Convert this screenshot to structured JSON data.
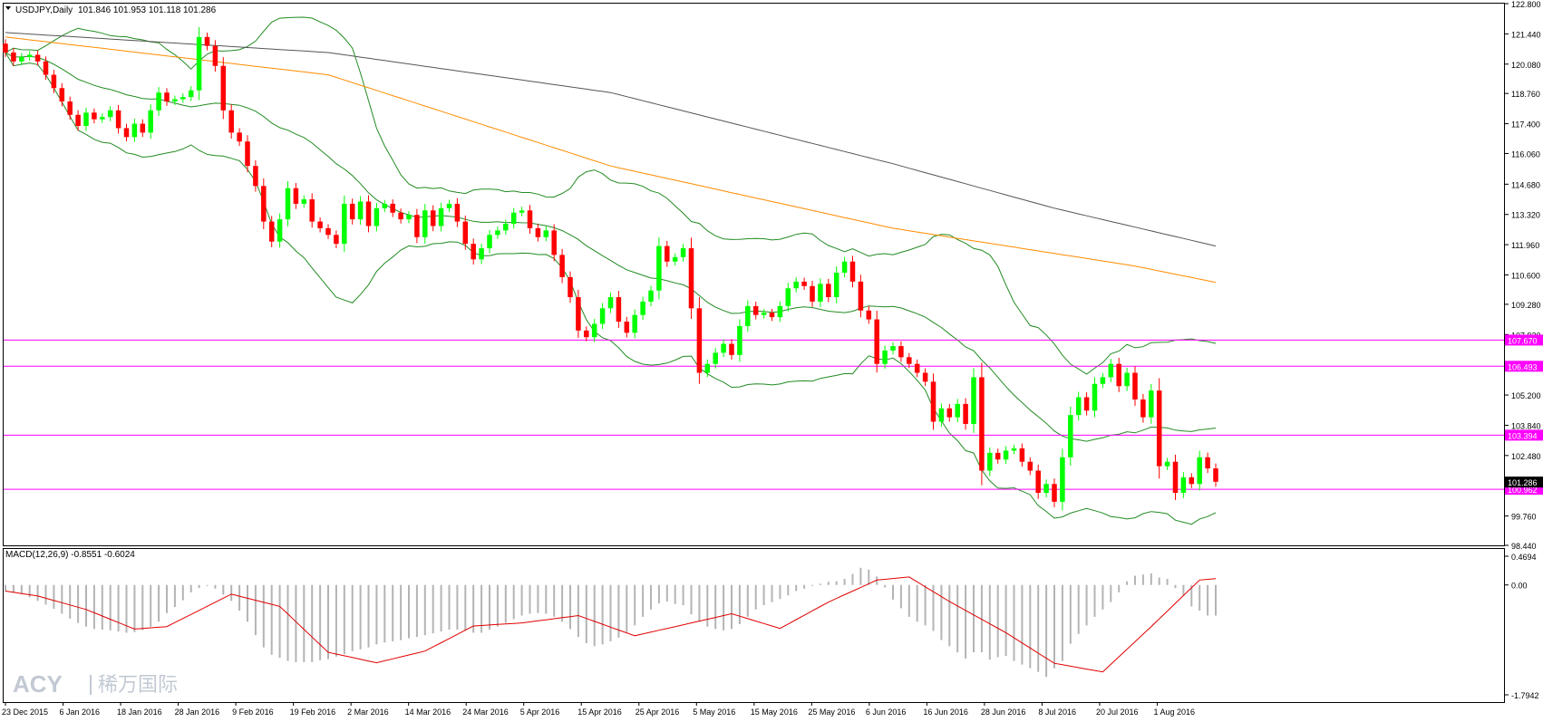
{
  "header": {
    "symbol_label": "USDJPY,Daily",
    "ohlc_label": "101.846 101.953 101.118 101.286",
    "macd_label": "MACD(12,26,9) -0.8551 -0.6024",
    "watermark_brand": "ACY",
    "watermark_cn": "稀万国际"
  },
  "colors": {
    "bull": "#00ff00",
    "bear": "#ff0000",
    "bollinger": "#228b22",
    "ma_orange": "#ff8c00",
    "ma_gray": "#555555",
    "hline": "#ff00ff",
    "macd_hist": "#b4b4b4",
    "macd_signal": "#e00000",
    "current_price_tag": "#000000"
  },
  "chart_data": [
    {
      "type": "candlestick",
      "title": "USDJPY,Daily",
      "y_axis": {
        "range": [
          98.44,
          122.8
        ],
        "ticks": [
          "122.800",
          "121.440",
          "120.080",
          "118.760",
          "117.400",
          "116.060",
          "114.680",
          "113.320",
          "111.960",
          "110.600",
          "109.280",
          "107.920",
          "105.200",
          "103.840",
          "102.480",
          "99.760",
          "98.440"
        ]
      },
      "x_axis": {
        "ticks": [
          "23 Dec 2015",
          "6 Jan 2016",
          "18 Jan 2016",
          "28 Jan 2016",
          "9 Feb 2016",
          "19 Feb 2016",
          "2 Mar 2016",
          "14 Mar 2016",
          "24 Mar 2016",
          "5 Apr 2016",
          "15 Apr 2016",
          "25 Apr 2016",
          "5 May 2016",
          "15 May 2016",
          "25 May 2016",
          "6 Jun 2016",
          "16 Jun 2016",
          "28 Jun 2016",
          "8 Jul 2016",
          "20 Jul 2016",
          "1 Aug 2016"
        ]
      },
      "current_price": "101.286",
      "horizontal_levels": [
        {
          "value": 107.67,
          "label": "107.670"
        },
        {
          "value": 106.493,
          "label": "106.493"
        },
        {
          "value": 103.394,
          "label": "103.394"
        },
        {
          "value": 100.962,
          "label": "100.962"
        }
      ],
      "candles": [
        [
          121.0,
          120.6
        ],
        [
          120.6,
          120.2
        ],
        [
          120.2,
          120.4
        ],
        [
          120.4,
          120.5
        ],
        [
          120.5,
          120.2
        ],
        [
          120.2,
          119.6
        ],
        [
          119.6,
          119.0
        ],
        [
          119.0,
          118.4
        ],
        [
          118.4,
          117.8
        ],
        [
          117.8,
          117.3
        ],
        [
          117.3,
          117.9
        ],
        [
          117.9,
          117.6
        ],
        [
          117.6,
          117.7
        ],
        [
          117.7,
          118.0
        ],
        [
          118.0,
          117.2
        ],
        [
          117.2,
          116.8
        ],
        [
          116.8,
          117.4
        ],
        [
          117.4,
          117.0
        ],
        [
          117.0,
          118.0
        ],
        [
          118.0,
          118.8
        ],
        [
          118.8,
          118.4
        ],
        [
          118.4,
          118.5
        ],
        [
          118.5,
          118.6
        ],
        [
          118.6,
          118.9
        ],
        [
          118.9,
          121.3
        ],
        [
          121.3,
          120.9
        ],
        [
          120.9,
          120.0
        ],
        [
          120.0,
          118.0
        ],
        [
          118.0,
          117.0
        ],
        [
          117.0,
          116.6
        ],
        [
          116.6,
          115.5
        ],
        [
          115.5,
          114.6
        ],
        [
          114.6,
          113.0
        ],
        [
          113.0,
          112.1
        ],
        [
          112.1,
          113.1
        ],
        [
          113.1,
          114.5
        ],
        [
          114.5,
          113.8
        ],
        [
          113.8,
          114.0
        ],
        [
          114.0,
          113.0
        ],
        [
          113.0,
          112.7
        ],
        [
          112.7,
          112.4
        ],
        [
          112.4,
          112.0
        ],
        [
          112.0,
          113.8
        ],
        [
          113.8,
          113.1
        ],
        [
          113.1,
          113.9
        ],
        [
          113.9,
          112.8
        ],
        [
          112.8,
          113.6
        ],
        [
          113.6,
          113.8
        ],
        [
          113.8,
          113.4
        ],
        [
          113.4,
          113.1
        ],
        [
          113.1,
          113.3
        ],
        [
          113.3,
          112.3
        ],
        [
          112.3,
          113.5
        ],
        [
          113.5,
          112.8
        ],
        [
          112.8,
          113.6
        ],
        [
          113.6,
          113.8
        ],
        [
          113.8,
          113.0
        ],
        [
          113.0,
          112.0
        ],
        [
          112.0,
          111.3
        ],
        [
          111.3,
          111.8
        ],
        [
          111.8,
          112.4
        ],
        [
          112.4,
          112.6
        ],
        [
          112.6,
          112.9
        ],
        [
          112.9,
          113.4
        ],
        [
          113.4,
          113.5
        ],
        [
          113.5,
          112.7
        ],
        [
          112.7,
          112.3
        ],
        [
          112.3,
          112.6
        ],
        [
          112.6,
          111.5
        ],
        [
          111.5,
          110.5
        ],
        [
          110.5,
          109.6
        ],
        [
          109.6,
          108.1
        ],
        [
          108.1,
          107.8
        ],
        [
          107.8,
          108.4
        ],
        [
          108.4,
          109.1
        ],
        [
          109.1,
          109.6
        ],
        [
          109.6,
          108.5
        ],
        [
          108.5,
          108.0
        ],
        [
          108.0,
          108.8
        ],
        [
          108.8,
          109.4
        ],
        [
          109.4,
          109.9
        ],
        [
          109.9,
          111.9
        ],
        [
          111.9,
          111.2
        ],
        [
          111.2,
          111.4
        ],
        [
          111.4,
          111.8
        ],
        [
          111.8,
          109.1
        ],
        [
          109.1,
          106.2
        ],
        [
          106.2,
          106.6
        ],
        [
          106.6,
          107.1
        ],
        [
          107.1,
          107.5
        ],
        [
          107.5,
          107.0
        ],
        [
          107.0,
          108.3
        ],
        [
          108.3,
          109.2
        ],
        [
          109.2,
          108.8
        ],
        [
          108.8,
          108.9
        ],
        [
          108.9,
          108.7
        ],
        [
          108.7,
          109.2
        ],
        [
          109.2,
          110.0
        ],
        [
          110.0,
          110.3
        ],
        [
          110.3,
          110.1
        ],
        [
          110.1,
          109.4
        ],
        [
          109.4,
          110.2
        ],
        [
          110.2,
          109.6
        ],
        [
          109.6,
          110.7
        ],
        [
          110.7,
          111.2
        ],
        [
          111.2,
          110.3
        ],
        [
          110.3,
          109.0
        ],
        [
          109.0,
          108.6
        ],
        [
          108.6,
          106.6
        ],
        [
          106.6,
          107.2
        ],
        [
          107.2,
          107.4
        ],
        [
          107.4,
          106.9
        ],
        [
          106.9,
          106.6
        ],
        [
          106.6,
          106.2
        ],
        [
          106.2,
          105.8
        ],
        [
          105.8,
          104.0
        ],
        [
          104.0,
          104.6
        ],
        [
          104.6,
          104.2
        ],
        [
          104.2,
          104.8
        ],
        [
          104.8,
          103.9
        ],
        [
          103.9,
          106.0
        ],
        [
          106.0,
          101.8
        ],
        [
          101.8,
          102.6
        ],
        [
          102.6,
          102.3
        ],
        [
          102.3,
          102.7
        ],
        [
          102.7,
          102.8
        ],
        [
          102.8,
          102.2
        ],
        [
          102.2,
          101.8
        ],
        [
          101.8,
          100.8
        ],
        [
          100.8,
          101.2
        ],
        [
          101.2,
          100.4
        ],
        [
          100.4,
          102.4
        ],
        [
          102.4,
          104.3
        ],
        [
          104.3,
          105.1
        ],
        [
          105.1,
          104.5
        ],
        [
          104.5,
          105.7
        ],
        [
          105.7,
          106.0
        ],
        [
          106.0,
          106.6
        ],
        [
          106.6,
          105.6
        ],
        [
          105.6,
          106.2
        ],
        [
          106.2,
          105.0
        ],
        [
          105.0,
          104.2
        ],
        [
          104.2,
          105.4
        ],
        [
          105.4,
          102.0
        ],
        [
          102.0,
          102.2
        ],
        [
          102.2,
          100.8
        ],
        [
          100.8,
          101.5
        ],
        [
          101.5,
          101.2
        ],
        [
          101.2,
          102.4
        ],
        [
          102.4,
          101.9
        ],
        [
          101.9,
          101.3
        ]
      ],
      "moving_average_orange": [
        [
          0,
          121.3
        ],
        [
          40,
          119.6
        ],
        [
          75,
          115.5
        ],
        [
          110,
          112.7
        ],
        [
          140,
          111.0
        ],
        [
          170,
          108.8
        ],
        [
          185,
          107.4
        ],
        [
          200,
          105.3
        ]
      ],
      "moving_average_gray": [
        [
          0,
          121.5
        ],
        [
          40,
          120.6
        ],
        [
          75,
          118.8
        ],
        [
          110,
          115.6
        ],
        [
          130,
          113.6
        ],
        [
          150,
          111.9
        ],
        [
          170,
          110.2
        ],
        [
          185,
          108.9
        ],
        [
          200,
          107.6
        ]
      ]
    },
    {
      "type": "bar+line",
      "title": "MACD(12,26,9) -0.8551 -0.6024",
      "y_axis": {
        "range": [
          -1.7942,
          0.4694
        ],
        "ticks": [
          "0.4694",
          "0.00",
          "-1.7942"
        ]
      },
      "histogram": [
        -0.1,
        -0.13,
        -0.15,
        -0.2,
        -0.26,
        -0.32,
        -0.39,
        -0.47,
        -0.55,
        -0.62,
        -0.68,
        -0.72,
        -0.73,
        -0.74,
        -0.76,
        -0.78,
        -0.77,
        -0.74,
        -0.68,
        -0.6,
        -0.46,
        -0.36,
        -0.25,
        -0.12,
        -0.05,
        0.0,
        -0.06,
        -0.16,
        -0.26,
        -0.42,
        -0.6,
        -0.82,
        -1.02,
        -1.14,
        -1.19,
        -1.24,
        -1.26,
        -1.26,
        -1.26,
        -1.23,
        -1.21,
        -1.17,
        -1.13,
        -1.08,
        -1.05,
        -1.02,
        -0.97,
        -0.94,
        -0.92,
        -0.9,
        -0.87,
        -0.85,
        -0.82,
        -0.79,
        -0.76,
        -0.73,
        -0.73,
        -0.75,
        -0.78,
        -0.78,
        -0.73,
        -0.68,
        -0.62,
        -0.56,
        -0.5,
        -0.47,
        -0.46,
        -0.47,
        -0.52,
        -0.6,
        -0.72,
        -0.85,
        -0.95,
        -1.0,
        -0.97,
        -0.92,
        -0.86,
        -0.77,
        -0.66,
        -0.52,
        -0.4,
        -0.3,
        -0.27,
        -0.31,
        -0.33,
        -0.48,
        -0.6,
        -0.68,
        -0.72,
        -0.74,
        -0.72,
        -0.64,
        -0.52,
        -0.4,
        -0.33,
        -0.28,
        -0.23,
        -0.17,
        -0.1,
        -0.06,
        0.0,
        0.02,
        0.05,
        0.06,
        0.1,
        0.18,
        0.28,
        0.25,
        0.14,
        -0.04,
        -0.24,
        -0.38,
        -0.52,
        -0.6,
        -0.66,
        -0.75,
        -0.9,
        -1.0,
        -1.1,
        -1.2,
        -1.1,
        -1.1,
        -1.22,
        -1.18,
        -1.16,
        -1.24,
        -1.3,
        -1.36,
        -1.42,
        -1.5,
        -1.36,
        -1.24,
        -0.96,
        -0.8,
        -0.66,
        -0.52,
        -0.4,
        -0.28,
        -0.12,
        0.06,
        0.15,
        0.17,
        0.19,
        0.12,
        0.1,
        -0.05,
        -0.18,
        -0.35,
        -0.42,
        -0.5,
        -0.5,
        -0.5,
        -0.56,
        -0.54,
        -0.59
      ],
      "signal": [
        [
          0,
          -0.1
        ],
        [
          4,
          -0.18
        ],
        [
          10,
          -0.4
        ],
        [
          16,
          -0.72
        ],
        [
          20,
          -0.68
        ],
        [
          28,
          -0.15
        ],
        [
          34,
          -0.35
        ],
        [
          40,
          -1.1
        ],
        [
          46,
          -1.27
        ],
        [
          52,
          -1.08
        ],
        [
          58,
          -0.67
        ],
        [
          64,
          -0.62
        ],
        [
          71,
          -0.5
        ],
        [
          78,
          -0.83
        ],
        [
          84,
          -0.65
        ],
        [
          90,
          -0.47
        ],
        [
          96,
          -0.71
        ],
        [
          102,
          -0.28
        ],
        [
          108,
          0.08
        ],
        [
          112,
          0.13
        ],
        [
          117,
          -0.27
        ],
        [
          124,
          -0.78
        ],
        [
          130,
          -1.28
        ],
        [
          136,
          -1.42
        ],
        [
          142,
          -0.68
        ],
        [
          148,
          0.08
        ],
        [
          153,
          0.14
        ],
        [
          158,
          -0.15
        ],
        [
          161,
          -0.35
        ]
      ]
    }
  ]
}
